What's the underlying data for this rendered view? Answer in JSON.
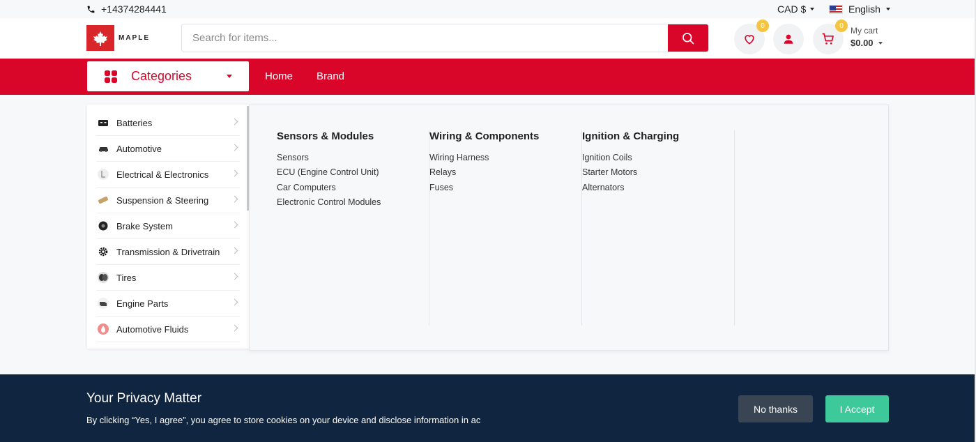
{
  "topbar": {
    "phone": "+14374284441",
    "currency": "CAD $",
    "language": "English"
  },
  "header": {
    "logo_text": "MAPLE",
    "search_placeholder": "Search for items...",
    "wishlist_count": "0",
    "cart_count": "0",
    "cart_label": "My cart",
    "cart_total": "$0.00"
  },
  "nav": {
    "categories_label": "Categories",
    "links": [
      "Home",
      "Brand"
    ]
  },
  "sidebar": {
    "items": [
      {
        "label": "Batteries",
        "icon": "battery-icon"
      },
      {
        "label": "Automotive",
        "icon": "car-icon"
      },
      {
        "label": "Electrical & Electronics",
        "icon": "electrical-icon"
      },
      {
        "label": "Suspension & Steering",
        "icon": "suspension-icon"
      },
      {
        "label": "Brake System",
        "icon": "brake-icon"
      },
      {
        "label": "Transmission & Drivetrain",
        "icon": "gear-icon"
      },
      {
        "label": "Tires",
        "icon": "tire-icon"
      },
      {
        "label": "Engine Parts",
        "icon": "engine-icon"
      },
      {
        "label": "Automotive Fluids",
        "icon": "fluid-icon"
      }
    ]
  },
  "mega_menu": {
    "columns": [
      {
        "title": "Sensors & Modules",
        "links": [
          "Sensors",
          "ECU (Engine Control Unit)",
          "Car Computers",
          "Electronic Control Modules"
        ]
      },
      {
        "title": "Wiring & Components",
        "links": [
          "Wiring Harness",
          "Relays",
          "Fuses"
        ]
      },
      {
        "title": "Ignition & Charging",
        "links": [
          "Ignition Coils",
          "Starter Motors",
          "Alternators"
        ]
      }
    ]
  },
  "privacy": {
    "title": "Your Privacy Matter",
    "text": "By clicking “Yes, I agree”, you agree to store cookies on your device and disclose information in ac",
    "decline_label": "No thanks",
    "accept_label": "I Accept"
  },
  "colors": {
    "brand_red": "#d9062a",
    "banner_navy": "#102540",
    "accept_green": "#3ec99a",
    "badge_yellow": "#f4c542"
  }
}
